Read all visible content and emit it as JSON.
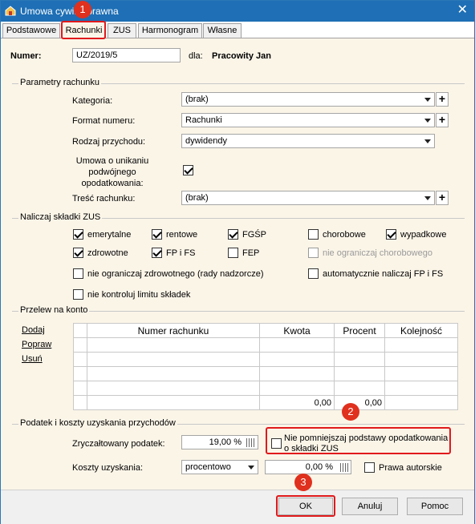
{
  "window": {
    "title": "Umowa cywilnoprawna",
    "close_glyph": "✕"
  },
  "tabs": [
    "Podstawowe",
    "Rachunki",
    "ZUS",
    "Harmonogram",
    "Własne"
  ],
  "header": {
    "numer_label": "Numer:",
    "numer_value": "UZ/2019/5",
    "dla_label": "dla:",
    "dla_value": "Pracowity Jan"
  },
  "params": {
    "group_title": "Parametry rachunku",
    "kategoria_label": "Kategoria:",
    "kategoria_value": "(brak)",
    "format_label": "Format numeru:",
    "format_value": "Rachunki",
    "rodzaj_label": "Rodzaj przychodu:",
    "rodzaj_value": "dywidendy",
    "umowa_label": "Umowa o unikaniu podwójnego opodatkowania:",
    "tresc_label": "Treść rachunku:",
    "tresc_value": "(brak)",
    "plus": "+"
  },
  "zus": {
    "group_title": "Naliczaj składki ZUS",
    "items": [
      "emerytalne",
      "rentowe",
      "FGŚP",
      "chorobowe",
      "wypadkowe",
      "zdrowotne",
      "FP i FS",
      "FEP",
      "nie ograniczaj chorobowego",
      "nie ograniczaj zdrowotnego (rady nadzorcze)",
      "automatycznie naliczaj FP i FS",
      "nie kontroluj limitu składek"
    ]
  },
  "przelew": {
    "group_title": "Przelew na konto",
    "links": [
      "Dodaj",
      "Popraw",
      "Usuń"
    ],
    "columns": [
      "Numer rachunku",
      "Kwota",
      "Procent",
      "Kolejność"
    ],
    "sum_kwota": "0,00",
    "sum_procent": "0,00"
  },
  "podatek": {
    "group_title": "Podatek i koszty uzyskania przychodów",
    "zryczaltowany_label": "Zryczałtowany podatek:",
    "zryczaltowany_value": "19,00 %",
    "nie_pomniejszaj_label": "Nie pomniejszaj podstawy opodatkowania o składki ZUS",
    "koszty_label": "Koszty uzyskania:",
    "koszty_type": "procentowo",
    "koszty_value": "0,00 %",
    "prawa_label": "Prawa autorskie"
  },
  "buttons": {
    "ok": "OK",
    "anuluj": "Anuluj",
    "pomoc": "Pomoc"
  },
  "markers": [
    "1",
    "2",
    "3"
  ],
  "colors": {
    "annotation_red": "#e0191b",
    "titlebar": "#1e6fb5",
    "dialog_bg": "#fbf5e8"
  }
}
